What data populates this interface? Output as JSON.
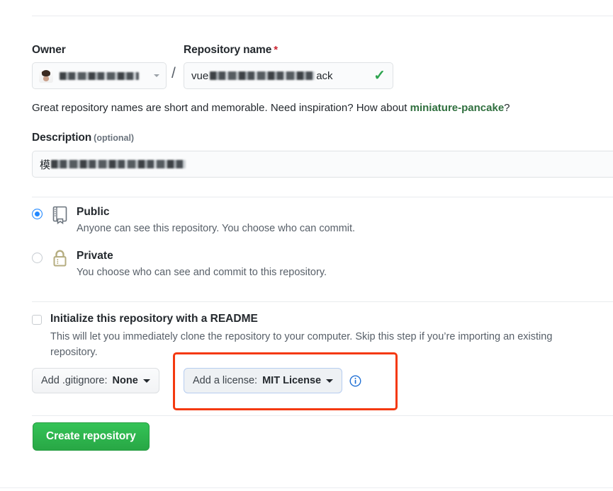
{
  "form": {
    "owner": {
      "label": "Owner",
      "value_redacted": true,
      "avatar_name": "owner-avatar"
    },
    "separator": "/",
    "repository_name": {
      "label": "Repository name",
      "required_marker": "*",
      "value_prefix": "vue",
      "value_suffix": "ack",
      "validation_icon": "check-icon",
      "validation_color": "#2ea44f"
    },
    "hint": {
      "text_before": "Great repository names are short and memorable. Need inspiration? How about ",
      "suggestion": "miniature-pancake",
      "text_after": "?"
    },
    "description": {
      "label": "Description",
      "optional_note": "(optional)",
      "value_visible_prefix": "模",
      "value_redacted": true
    },
    "visibility": {
      "options": [
        {
          "id": "public",
          "title": "Public",
          "description": "Anyone can see this repository. You choose who can commit.",
          "icon": "repo-icon",
          "selected": true
        },
        {
          "id": "private",
          "title": "Private",
          "description": "You choose who can see and commit to this repository.",
          "icon": "lock-icon",
          "selected": false
        }
      ]
    },
    "initialize": {
      "title": "Initialize this repository with a README",
      "description": "This will let you immediately clone the repository to your computer. Skip this step if you’re importing an existing repository.",
      "checked": false
    },
    "gitignore": {
      "lead": "Add .gitignore:",
      "value": "None"
    },
    "license": {
      "lead": "Add a license:",
      "value": "MIT License",
      "info_icon": "info-icon",
      "focused": true
    },
    "submit": {
      "label": "Create repository",
      "color": "#28a745"
    }
  },
  "annotation": {
    "highlight_color": "#f4390f",
    "target": "license-dropdown"
  }
}
